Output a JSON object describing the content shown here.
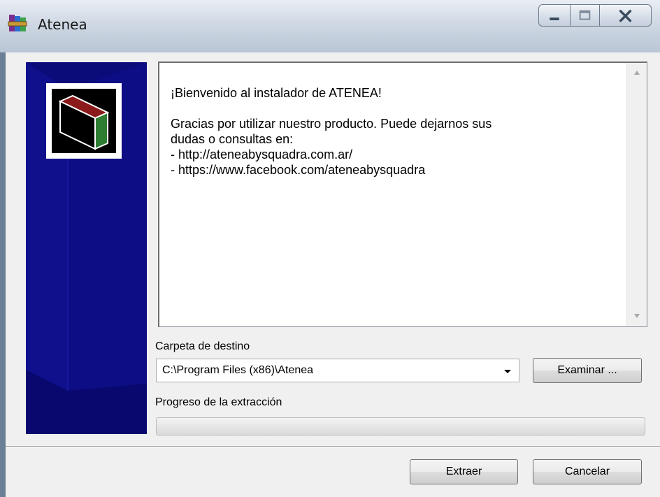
{
  "window": {
    "title": "Atenea",
    "icon": "winrar-books-icon"
  },
  "title_buttons": {
    "minimize": "minimize-icon",
    "maximize": "maximize-icon",
    "close": "close-icon"
  },
  "message": {
    "line1": "¡Bienvenido al instalador de ATENEA!",
    "line2": "Gracias por utilizar nuestro producto. Puede dejarnos sus",
    "line3": "dudas o consultas en:",
    "line4": "- http://ateneabysquadra.com.ar/",
    "line5": "- https://www.facebook.com/ateneabysquadra"
  },
  "destination": {
    "label": "Carpeta de destino",
    "value": "C:\\Program Files (x86)\\Atenea",
    "browse_label": "Examinar ..."
  },
  "progress": {
    "label": "Progreso de la extracción",
    "fraction": 0
  },
  "footer": {
    "extract_label": "Extraer",
    "cancel_label": "Cancelar"
  },
  "colors": {
    "banner": "#0b0b7a",
    "logo_top": "#8b1a1a",
    "logo_side": "#2e7d32"
  }
}
